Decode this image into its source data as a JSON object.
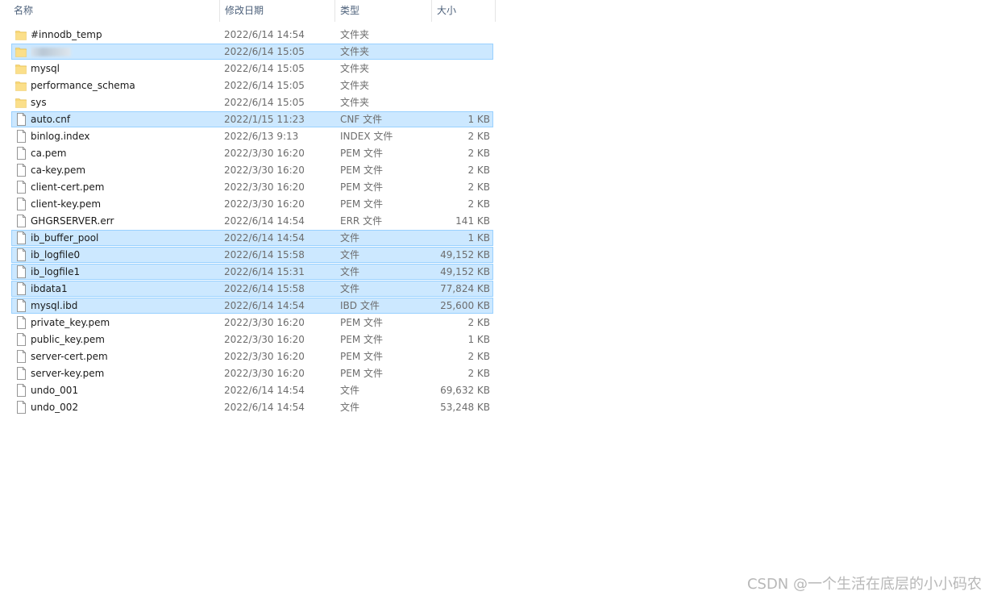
{
  "header": {
    "columns": {
      "name": "名称",
      "date": "修改日期",
      "type": "类型",
      "size": "大小"
    },
    "sort_indicator": "^"
  },
  "colors": {
    "selection_bg": "#cce8ff",
    "selection_border": "#99d1ff",
    "folder_yellow": "#f8d775",
    "header_text": "#4c607a"
  },
  "files": [
    {
      "icon": "folder-icon",
      "name": "#innodb_temp",
      "date": "2022/6/14 14:54",
      "type": "文件夹",
      "size": "",
      "selected": false
    },
    {
      "icon": "folder-icon",
      "name": "",
      "date": "2022/6/14 15:05",
      "type": "文件夹",
      "size": "",
      "selected": true,
      "blurred": true
    },
    {
      "icon": "folder-icon",
      "name": "mysql",
      "date": "2022/6/14 15:05",
      "type": "文件夹",
      "size": "",
      "selected": false
    },
    {
      "icon": "folder-icon",
      "name": "performance_schema",
      "date": "2022/6/14 15:05",
      "type": "文件夹",
      "size": "",
      "selected": false
    },
    {
      "icon": "folder-icon",
      "name": "sys",
      "date": "2022/6/14 15:05",
      "type": "文件夹",
      "size": "",
      "selected": false
    },
    {
      "icon": "file-icon",
      "name": "auto.cnf",
      "date": "2022/1/15 11:23",
      "type": "CNF 文件",
      "size": "1 KB",
      "selected": true
    },
    {
      "icon": "file-icon",
      "name": "binlog.index",
      "date": "2022/6/13 9:13",
      "type": "INDEX 文件",
      "size": "2 KB",
      "selected": false
    },
    {
      "icon": "file-icon",
      "name": "ca.pem",
      "date": "2022/3/30 16:20",
      "type": "PEM 文件",
      "size": "2 KB",
      "selected": false
    },
    {
      "icon": "file-icon",
      "name": "ca-key.pem",
      "date": "2022/3/30 16:20",
      "type": "PEM 文件",
      "size": "2 KB",
      "selected": false
    },
    {
      "icon": "file-icon",
      "name": "client-cert.pem",
      "date": "2022/3/30 16:20",
      "type": "PEM 文件",
      "size": "2 KB",
      "selected": false
    },
    {
      "icon": "file-icon",
      "name": "client-key.pem",
      "date": "2022/3/30 16:20",
      "type": "PEM 文件",
      "size": "2 KB",
      "selected": false
    },
    {
      "icon": "file-icon",
      "name": "GHGRSERVER.err",
      "date": "2022/6/14 14:54",
      "type": "ERR 文件",
      "size": "141 KB",
      "selected": false
    },
    {
      "icon": "file-icon",
      "name": "ib_buffer_pool",
      "date": "2022/6/14 14:54",
      "type": "文件",
      "size": "1 KB",
      "selected": true
    },
    {
      "icon": "file-icon",
      "name": "ib_logfile0",
      "date": "2022/6/14 15:58",
      "type": "文件",
      "size": "49,152 KB",
      "selected": true
    },
    {
      "icon": "file-icon",
      "name": "ib_logfile1",
      "date": "2022/6/14 15:31",
      "type": "文件",
      "size": "49,152 KB",
      "selected": true
    },
    {
      "icon": "file-icon",
      "name": "ibdata1",
      "date": "2022/6/14 15:58",
      "type": "文件",
      "size": "77,824 KB",
      "selected": true
    },
    {
      "icon": "file-icon",
      "name": "mysql.ibd",
      "date": "2022/6/14 14:54",
      "type": "IBD 文件",
      "size": "25,600 KB",
      "selected": true
    },
    {
      "icon": "file-icon",
      "name": "private_key.pem",
      "date": "2022/3/30 16:20",
      "type": "PEM 文件",
      "size": "2 KB",
      "selected": false
    },
    {
      "icon": "file-icon",
      "name": "public_key.pem",
      "date": "2022/3/30 16:20",
      "type": "PEM 文件",
      "size": "1 KB",
      "selected": false
    },
    {
      "icon": "file-icon",
      "name": "server-cert.pem",
      "date": "2022/3/30 16:20",
      "type": "PEM 文件",
      "size": "2 KB",
      "selected": false
    },
    {
      "icon": "file-icon",
      "name": "server-key.pem",
      "date": "2022/3/30 16:20",
      "type": "PEM 文件",
      "size": "2 KB",
      "selected": false
    },
    {
      "icon": "file-icon",
      "name": "undo_001",
      "date": "2022/6/14 14:54",
      "type": "文件",
      "size": "69,632 KB",
      "selected": false
    },
    {
      "icon": "file-icon",
      "name": "undo_002",
      "date": "2022/6/14 14:54",
      "type": "文件",
      "size": "53,248 KB",
      "selected": false
    }
  ],
  "watermark": "CSDN @一个生活在底层的小小码农"
}
